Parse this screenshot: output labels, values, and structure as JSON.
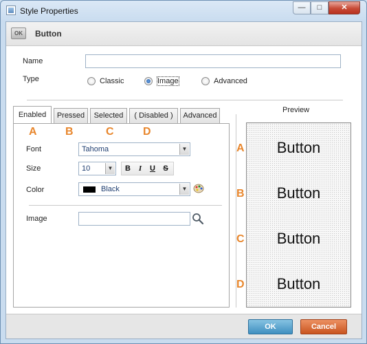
{
  "window": {
    "title": "Style Properties",
    "minimize": "—",
    "maximize": "□",
    "close": "✕"
  },
  "header": {
    "icon_text": "OK",
    "title": "Button"
  },
  "form": {
    "name_label": "Name",
    "name_value": "",
    "type_label": "Type",
    "type_options": [
      "Classic",
      "Image",
      "Advanced"
    ],
    "type_selected": "Image"
  },
  "tabs": [
    "Enabled",
    "Pressed",
    "Selected",
    "( Disabled )",
    "Advanced"
  ],
  "active_tab": "Enabled",
  "state_letters": [
    "A",
    "B",
    "C",
    "D"
  ],
  "font": {
    "label": "Font",
    "value": "Tahoma"
  },
  "size": {
    "label": "Size",
    "value": "10"
  },
  "format_buttons": [
    "B",
    "I",
    "U",
    "S"
  ],
  "color": {
    "label": "Color",
    "value": "Black",
    "swatch": "#000000"
  },
  "image": {
    "label": "Image",
    "value": ""
  },
  "preview": {
    "label": "Preview",
    "button_text": "Button",
    "letters": [
      "A",
      "B",
      "C",
      "D"
    ]
  },
  "buttons": {
    "ok": "OK",
    "cancel": "Cancel"
  },
  "colors": {
    "accent_letter": "#e8862c",
    "ok": "#3f8fc0",
    "cancel": "#c9541f"
  }
}
